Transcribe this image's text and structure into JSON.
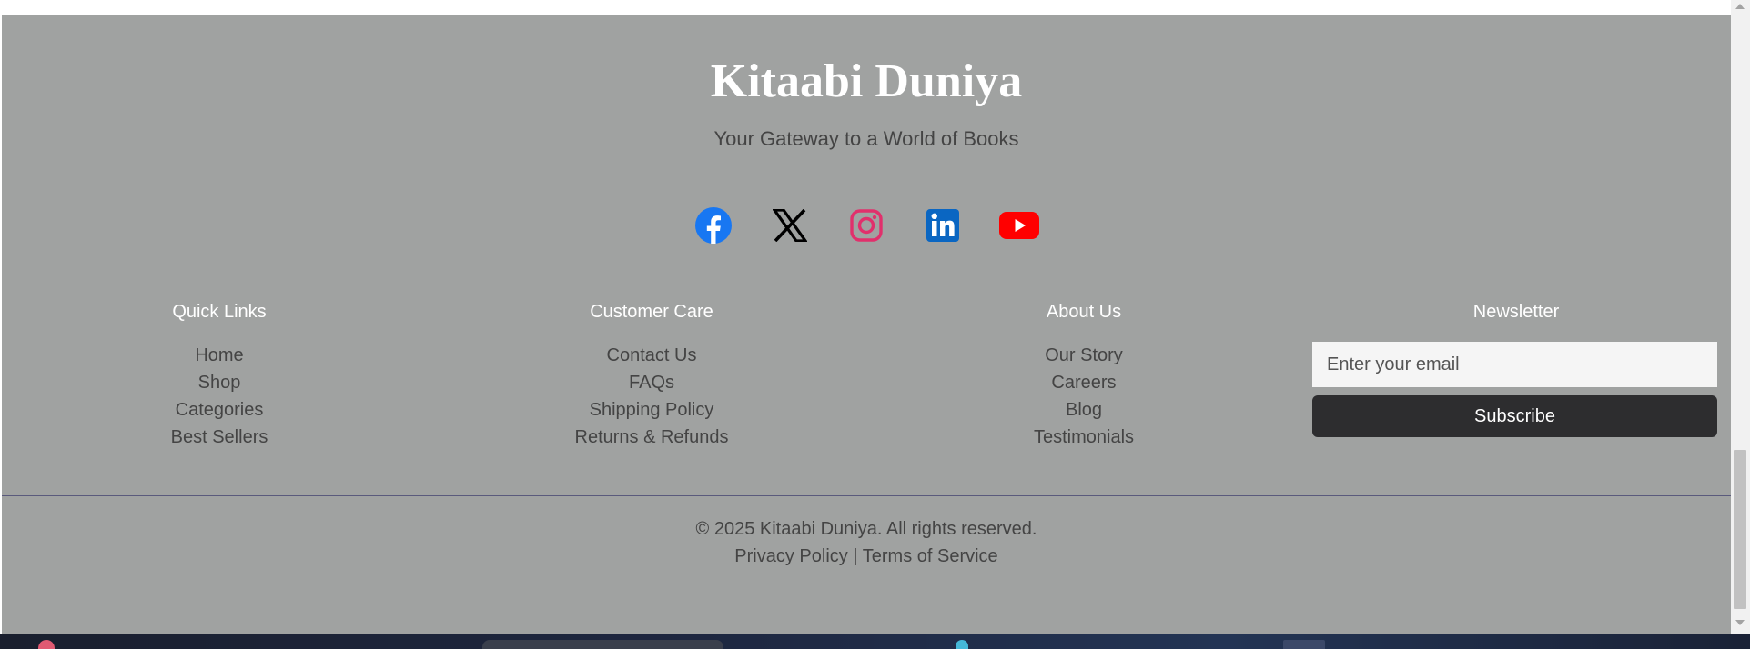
{
  "brand": {
    "title": "Kitaabi Duniya",
    "tagline": "Your Gateway to a World of Books"
  },
  "social": [
    {
      "icon": "facebook-icon",
      "color": "#1877f2"
    },
    {
      "icon": "x-icon",
      "color": "#000000"
    },
    {
      "icon": "instagram-icon",
      "color": "#e1306c"
    },
    {
      "icon": "linkedin-icon",
      "color": "#0a66c2"
    },
    {
      "icon": "youtube-icon",
      "color": "#ff0000"
    }
  ],
  "columns": {
    "quick_links": {
      "heading": "Quick Links",
      "items": [
        "Home",
        "Shop",
        "Categories",
        "Best Sellers"
      ]
    },
    "customer_care": {
      "heading": "Customer Care",
      "items": [
        "Contact Us",
        "FAQs",
        "Shipping Policy",
        "Returns & Refunds"
      ]
    },
    "about_us": {
      "heading": "About Us",
      "items": [
        "Our Story",
        "Careers",
        "Blog",
        "Testimonials"
      ]
    },
    "newsletter": {
      "heading": "Newsletter",
      "email_placeholder": "Enter your email",
      "subscribe_label": "Subscribe"
    }
  },
  "bottom": {
    "copyright": "© 2025 Kitaabi Duniya. All rights reserved.",
    "privacy_label": "Privacy Policy",
    "separator": "|",
    "terms_label": "Terms of Service"
  },
  "colors": {
    "footer_bg": "#a0a2a1",
    "button_bg": "#2d2d2f",
    "divider": "#5a5a7c"
  }
}
